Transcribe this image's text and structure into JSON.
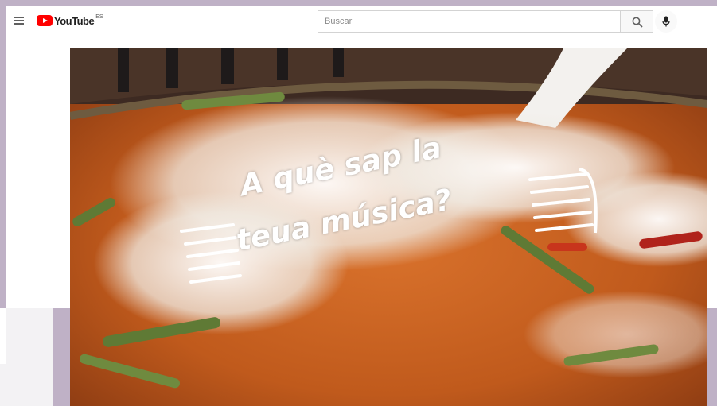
{
  "header": {
    "logo_text": "YouTube",
    "country_code": "ES",
    "search_placeholder": "Buscar"
  },
  "video": {
    "title_line1": "A què sap la",
    "title_line2": "teua música?"
  },
  "icons": [
    "menu-icon",
    "youtube-logo",
    "search-icon",
    "microphone-icon"
  ]
}
